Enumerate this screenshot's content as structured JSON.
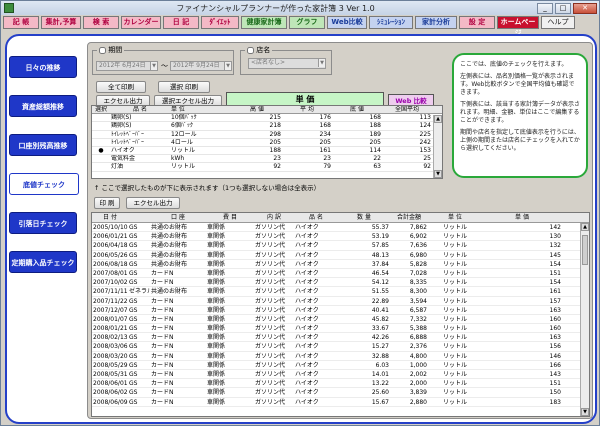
{
  "window": {
    "title": "ファイナンシャルプランナーが作った家計簿 3  Ver 1.0",
    "min": "_",
    "max": "□",
    "close": "✕"
  },
  "menu": [
    "記 帳",
    "集計,予算",
    "検 索",
    "カレンダー",
    "日 記",
    "ﾀﾞｲｴｯﾄ",
    "健康家計簿",
    "グラフ",
    "Web比較",
    "ｼﾐｭﾚｰｼｮﾝ",
    "家計分析",
    "設 定",
    "ホームページ",
    "ヘルプ"
  ],
  "nav": [
    "日々の推移",
    "資産総額推移",
    "口座別残高推移",
    "底値チェック",
    "引落日チェック",
    "定期購入品チェック"
  ],
  "period": {
    "legend": "期間",
    "from": "2012年 6月24日",
    "tilde": "〜",
    "to": "2012年 9月24日"
  },
  "store": {
    "legend": "店名",
    "value": "<店名なし>"
  },
  "buttons": {
    "print_all": "全て印刷",
    "print_sel": "選択 印刷",
    "excel": "エクセル出力",
    "excel_sel": "選択エクセル出力",
    "print": "印 刷",
    "excel2": "エクセル出力"
  },
  "tabs": {
    "unit": "単 価",
    "web": "Web 比較"
  },
  "info": [
    "ここでは、底値のチェックを行えます。",
    "左側表には、品名別価格一覧が表示されます。Web比較ボタンで全国平均値も確認できます。",
    "下側表には、該当する家計簿データが表示されます。明細、金額、単位はここで編集することができます。",
    "期間や店名を指定して底値表示を行うには、上側の期間または店名にチェックを入れてから選択してください。"
  ],
  "item_headers": [
    "選択",
    "品 名",
    "単 位",
    "高 値",
    "平 均",
    "底 値",
    "全国平均"
  ],
  "items": [
    {
      "sel": "",
      "name": "鶏卵(S)",
      "unit": "10個ﾊﾟｯｸ",
      "hi": "215",
      "av": "176",
      "lo": "168",
      "nat": "113"
    },
    {
      "sel": "",
      "name": "鶏卵(S)",
      "unit": "6個ﾊﾟｯｸ",
      "hi": "218",
      "av": "168",
      "lo": "188",
      "nat": "124"
    },
    {
      "sel": "",
      "name": "ﾄｲﾚｯﾄﾍﾟｰﾊﾟｰ",
      "unit": "12ロール",
      "hi": "298",
      "av": "234",
      "lo": "189",
      "nat": "225"
    },
    {
      "sel": "",
      "name": "ﾄｲﾚｯﾄﾍﾟｰﾊﾟｰ",
      "unit": "4ロール",
      "hi": "205",
      "av": "205",
      "lo": "205",
      "nat": "242"
    },
    {
      "sel": "●",
      "name": "ハイオク",
      "unit": "リットル",
      "hi": "188",
      "av": "161",
      "lo": "114",
      "nat": "153"
    },
    {
      "sel": "",
      "name": "電気料金",
      "unit": "kWh",
      "hi": "23",
      "av": "23",
      "lo": "22",
      "nat": "25"
    },
    {
      "sel": "",
      "name": "灯油",
      "unit": "リットル",
      "hi": "92",
      "av": "79",
      "lo": "63",
      "nat": "92"
    }
  ],
  "note": "↑ ここで選択したものが下に表示されます（1つも選択しない場合は全表示）",
  "hist_headers": [
    "日 付",
    "口 座",
    "費 目",
    "内 訳",
    "品 名",
    "数 量",
    "合計金額",
    "単 位",
    "単 価"
  ],
  "history": [
    [
      "2005/10/10",
      "GS",
      "共通のお財布",
      "車関係",
      "ガソリン代",
      "ハイオク",
      "55.37",
      "7,862",
      "リットル",
      "142"
    ],
    [
      "2006/01/21",
      "GS",
      "共通のお財布",
      "車関係",
      "ガソリン代",
      "ハイオク",
      "53.19",
      "6,902",
      "リットル",
      "130"
    ],
    [
      "2006/04/18",
      "GS",
      "共通のお財布",
      "車関係",
      "ガソリン代",
      "ハイオク",
      "57.85",
      "7,636",
      "リットル",
      "132"
    ],
    [
      "2006/05/26",
      "GS",
      "共通のお財布",
      "車関係",
      "ガソリン代",
      "ハイオク",
      "48.13",
      "6,980",
      "リットル",
      "145"
    ],
    [
      "2006/08/18",
      "GS",
      "共通のお財布",
      "車関係",
      "ガソリン代",
      "ハイオク",
      "37.84",
      "5,828",
      "リットル",
      "154"
    ],
    [
      "2007/08/01",
      "GS",
      "カードN",
      "車関係",
      "ガソリン代",
      "ハイオク",
      "46.54",
      "7,028",
      "リットル",
      "151"
    ],
    [
      "2007/10/02",
      "GS",
      "カードN",
      "車関係",
      "ガソリン代",
      "ハイオク",
      "54.12",
      "8,335",
      "リットル",
      "154"
    ],
    [
      "2007/11/11",
      "ゼネラル",
      "共通のお財布",
      "車関係",
      "ガソリン代",
      "ハイオク",
      "51.55",
      "8,300",
      "リットル",
      "161"
    ],
    [
      "2007/11/22",
      "GS",
      "カードN",
      "車関係",
      "ガソリン代",
      "ハイオク",
      "22.89",
      "3,594",
      "リットル",
      "157"
    ],
    [
      "2007/12/07",
      "GS",
      "カードN",
      "車関係",
      "ガソリン代",
      "ハイオク",
      "40.41",
      "6,587",
      "リットル",
      "163"
    ],
    [
      "2008/01/07",
      "GS",
      "カードN",
      "車関係",
      "ガソリン代",
      "ハイオク",
      "45.82",
      "7,332",
      "リットル",
      "160"
    ],
    [
      "2008/01/21",
      "GS",
      "カードN",
      "車関係",
      "ガソリン代",
      "ハイオク",
      "33.67",
      "5,388",
      "リットル",
      "160"
    ],
    [
      "2008/02/13",
      "GS",
      "カードN",
      "車関係",
      "ガソリン代",
      "ハイオク",
      "42.26",
      "6,888",
      "リットル",
      "163"
    ],
    [
      "2008/03/06",
      "GS",
      "カードN",
      "車関係",
      "ガソリン代",
      "ハイオク",
      "15.27",
      "2,376",
      "リットル",
      "156"
    ],
    [
      "2008/03/20",
      "GS",
      "カードN",
      "車関係",
      "ガソリン代",
      "ハイオク",
      "32.88",
      "4,800",
      "リットル",
      "146"
    ],
    [
      "2008/05/29",
      "GS",
      "カードN",
      "車関係",
      "ガソリン代",
      "ハイオク",
      "6.03",
      "1,000",
      "リットル",
      "166"
    ],
    [
      "2008/05/31",
      "GS",
      "カードN",
      "車関係",
      "ガソリン代",
      "ハイオク",
      "14.01",
      "2,002",
      "リットル",
      "143"
    ],
    [
      "2008/06/01",
      "GS",
      "カードN",
      "車関係",
      "ガソリン代",
      "ハイオク",
      "13.22",
      "2,000",
      "リットル",
      "151"
    ],
    [
      "2008/06/02",
      "GS",
      "カードN",
      "車関係",
      "ガソリン代",
      "ハイオク",
      "25.60",
      "3,839",
      "リットル",
      "150"
    ],
    [
      "2008/06/09",
      "GS",
      "カードN",
      "車関係",
      "ガソリン代",
      "ハイオク",
      "15.67",
      "2,880",
      "リットル",
      "183"
    ]
  ]
}
